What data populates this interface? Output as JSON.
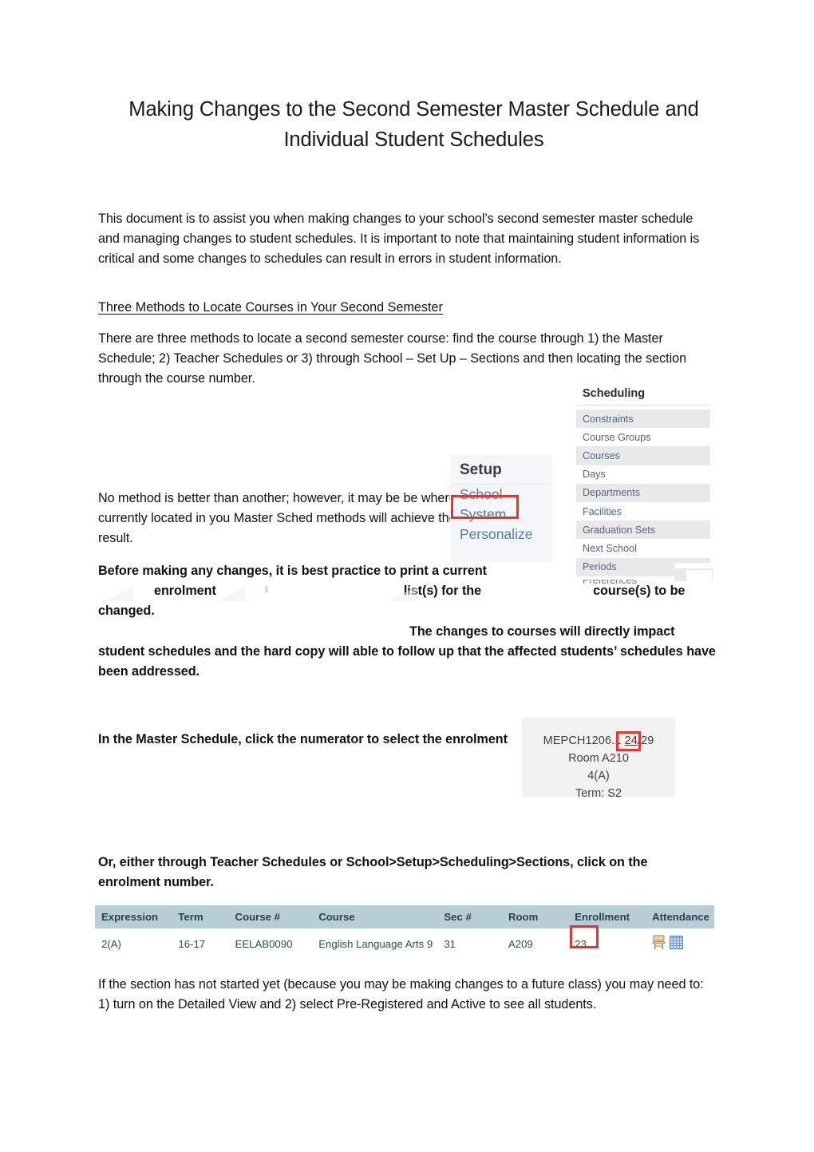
{
  "document": {
    "title": "Making Changes to the Second Semester Master Schedule and Individual Student Schedules",
    "intro_paragraph": "This document is to assist you when making changes to your school’s second semester master schedule and managing changes to student schedules. It is important to note that maintaining student information is critical and some changes to schedules can result in errors in student information.",
    "methods_heading": "Three Methods to Locate Courses in Your Second Semester",
    "methods_paragraph": "There are three methods to locate a second semester course: find the course through 1) the Master Schedule; 2) Teacher Schedules or 3) through School – Set Up – Sections and then locating the section through the course number.",
    "no_method_paragraph": "No method is better than another; however, it may be be where the course is currently located in you Master Sched methods will achieve the same end result.",
    "best_practice": {
      "line1": "Before making any changes, it is best practice to print a current",
      "word_enrolment": "enrolment",
      "word_lists_for_the": "list(s) for the",
      "word_courses_to_be_changed": "course(s) to be changed.",
      "line2": "The changes to courses will directly impact",
      "line3": "student schedules and the hard copy will able to follow up that the affected students’ schedules have been addressed."
    },
    "master_schedule_instruction": "In the Master Schedule, click the numerator to select the enrolment",
    "teacher_schedules_instruction": "Or, either through Teacher Schedules or School>Setup>Scheduling>Sections, click on the enrolment number.",
    "detailed_view_paragraph": "If the section has not started yet (because you may be making changes to a future class) you may need to: 1) turn on the Detailed View and 2) select Pre-Registered and Active to see all students."
  },
  "scheduling_panel": {
    "title": "Scheduling",
    "items": [
      {
        "label": "Constraints"
      },
      {
        "label": "Course Groups"
      },
      {
        "label": "Courses"
      },
      {
        "label": "Days"
      },
      {
        "label": "Departments"
      },
      {
        "label": "Facilities"
      },
      {
        "label": "Graduation Sets"
      },
      {
        "label": "Next School"
      },
      {
        "label": "Periods"
      },
      {
        "label": "Preferences"
      }
    ]
  },
  "setup_panel": {
    "title": "Setup",
    "items": [
      {
        "label": "School",
        "highlighted": true
      },
      {
        "label": "System",
        "highlighted": false
      },
      {
        "label": "Personalize",
        "highlighted": false
      }
    ],
    "highlight_color": "#e8342a"
  },
  "course_card": {
    "course_number": "MEPCH1206.1",
    "numerator": "24",
    "separator": "/",
    "denominator": "29",
    "room": "Room A210",
    "expression": "4(A)",
    "term": "Term: S2",
    "highlight_color": "#e8342a"
  },
  "sections_table": {
    "headers": [
      "Expression",
      "Term",
      "Course #",
      "Course",
      "Sec #",
      "Room",
      "Enrollment",
      "Attendance"
    ],
    "rows": [
      {
        "expression": "2(A)",
        "term": "16-17",
        "course_number": "EELAB0090",
        "course": "English Language Arts 9",
        "sec_number": "31",
        "room": "A209",
        "enrollment": "23",
        "attendance_icons": [
          "desk-icon",
          "grid-icon"
        ]
      }
    ],
    "header_background": "#b7cdd8",
    "highlight_color": "#e8342a"
  }
}
